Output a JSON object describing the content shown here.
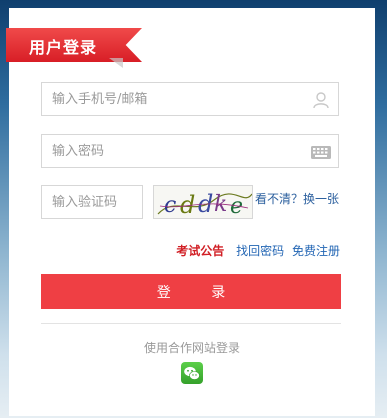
{
  "login": {
    "title": "用户登录",
    "phone_placeholder": "输入手机号/邮箱",
    "password_placeholder": "输入密码",
    "captcha_placeholder": "输入验证码",
    "captcha_refresh": "看不清？换一张",
    "links": {
      "notice": "考试公告",
      "recover_password": "找回密码",
      "register": "免费注册"
    },
    "submit_label": "登 录",
    "partner_login_text": "使用合作网站登录"
  },
  "icons": {
    "user": "user-icon",
    "keyboard": "keyboard-icon",
    "wechat": "wechat-icon"
  },
  "colors": {
    "accent": "#ef3f44",
    "link_blue": "#2366b4",
    "notice_red": "#d11f25"
  }
}
